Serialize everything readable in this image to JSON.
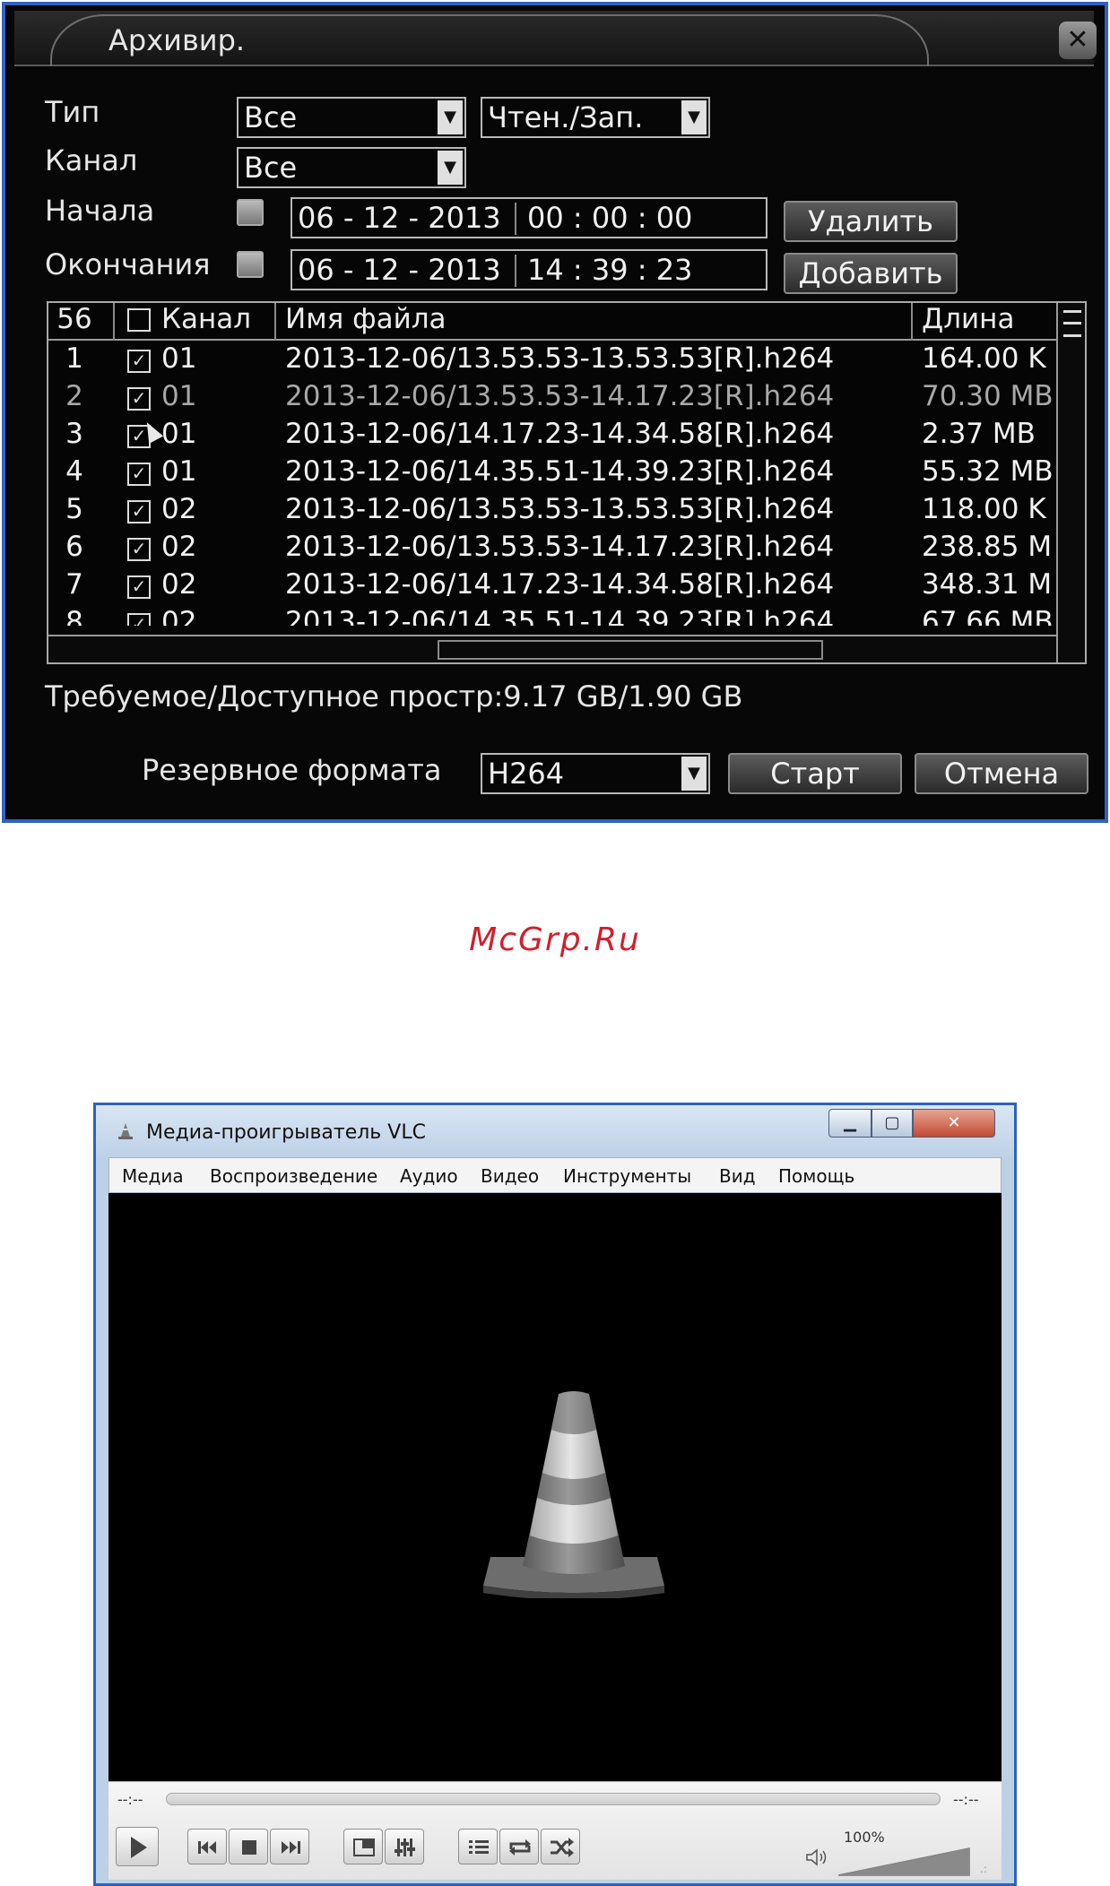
{
  "dvr": {
    "title": "Архивир.",
    "close_icon": "close-icon",
    "labels": {
      "type": "Тип",
      "channel": "Канал",
      "start": "Начала",
      "end": "Окончания"
    },
    "type_select": "Все",
    "mode_select": "Чтен./Зап.",
    "channel_select": "Все",
    "start_date": "06 - 12 - 2013",
    "start_time": "00 : 00 : 00",
    "end_date": "06 - 12 - 2013",
    "end_time": "14 : 39 : 23",
    "delete_label": "Удалить",
    "add_label": "Добавить",
    "table": {
      "headers": {
        "count": "56",
        "channel": "Канал",
        "filename": "Имя файла",
        "length": "Длина"
      },
      "rows": [
        {
          "num": "1",
          "ch": "01",
          "file": "2013-12-06/13.53.53-13.53.53[R].h264",
          "len": "164.00 K"
        },
        {
          "num": "2",
          "ch": "01",
          "file": "2013-12-06/13.53.53-14.17.23[R].h264",
          "len": "70.30 MB"
        },
        {
          "num": "3",
          "ch": "01",
          "file": "2013-12-06/14.17.23-14.34.58[R].h264",
          "len": "2.37 MB"
        },
        {
          "num": "4",
          "ch": "01",
          "file": "2013-12-06/14.35.51-14.39.23[R].h264",
          "len": "55.32 MB"
        },
        {
          "num": "5",
          "ch": "02",
          "file": "2013-12-06/13.53.53-13.53.53[R].h264",
          "len": "118.00 K"
        },
        {
          "num": "6",
          "ch": "02",
          "file": "2013-12-06/13.53.53-14.17.23[R].h264",
          "len": "238.85 M"
        },
        {
          "num": "7",
          "ch": "02",
          "file": "2013-12-06/14.17.23-14.34.58[R].h264",
          "len": "348.31 M"
        },
        {
          "num": "8",
          "ch": "02",
          "file": "2013-12-06/14.35.51-14.39.23[R].h264",
          "len": "67.66 MB"
        }
      ]
    },
    "space_text": "Требуемое/Доступное простр:9.17 GB/1.90 GB",
    "format_label": "Резервное формата",
    "format_select": "H264",
    "start_label": "Старт",
    "cancel_label": "Отмена"
  },
  "watermark": "McGrp.Ru",
  "vlc": {
    "title": "Медиа-проигрыватель VLC",
    "menu": [
      "Медиа",
      "Воспроизведение",
      "Аудио",
      "Видео",
      "Инструменты",
      "Вид",
      "Помощь"
    ],
    "time_elapsed": "--:--",
    "time_total": "--:--",
    "volume": "100%",
    "icons": {
      "app": "vlc-cone-icon",
      "play": "play-icon",
      "prev": "previous-icon",
      "stop": "stop-icon",
      "next": "next-icon",
      "fullscreen": "fullscreen-icon",
      "settings": "equalizer-icon",
      "playlist": "playlist-icon",
      "loop": "loop-icon",
      "shuffle": "shuffle-icon",
      "speaker": "speaker-icon"
    }
  }
}
